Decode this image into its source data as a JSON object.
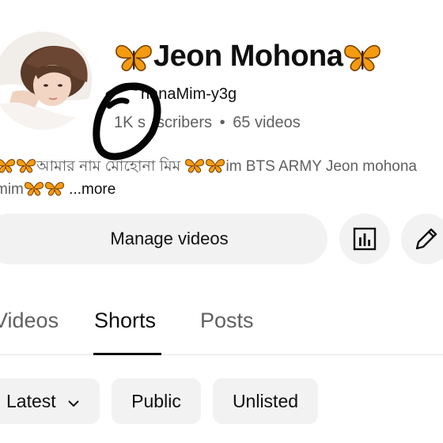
{
  "channel": {
    "name": "Jeon Mohona",
    "handle": "@MohanaMim-y3g",
    "handle_visible": "hanaMim-y3g",
    "subscribers": "1K subscribers",
    "subscribers_visible_a": "1K s",
    "subscribers_visible_b": "scribers",
    "separator": "•",
    "videos": "65 videos",
    "description_line1_a": "আমার নাম",
    "description_line1_b": "মোহোনা মিম",
    "description_line1_c": "im BTS ARMY Jeon mohona",
    "description_line2": "mim",
    "more_label": "...more"
  },
  "actions": {
    "manage_videos_label": "Manage videos",
    "analytics_icon": "analytics-icon",
    "edit_icon": "pencil-icon"
  },
  "tabs": [
    {
      "label": "Videos",
      "active": false
    },
    {
      "label": "Shorts",
      "active": true
    },
    {
      "label": "Posts",
      "active": false
    }
  ],
  "filters": {
    "sort_label": "Latest",
    "chips": [
      "Public",
      "Unlisted"
    ]
  },
  "colors": {
    "text_primary": "#0f0f0f",
    "text_secondary": "#606060",
    "button_bg": "#f2f2f2",
    "butterfly_orange": "#f39c12"
  }
}
